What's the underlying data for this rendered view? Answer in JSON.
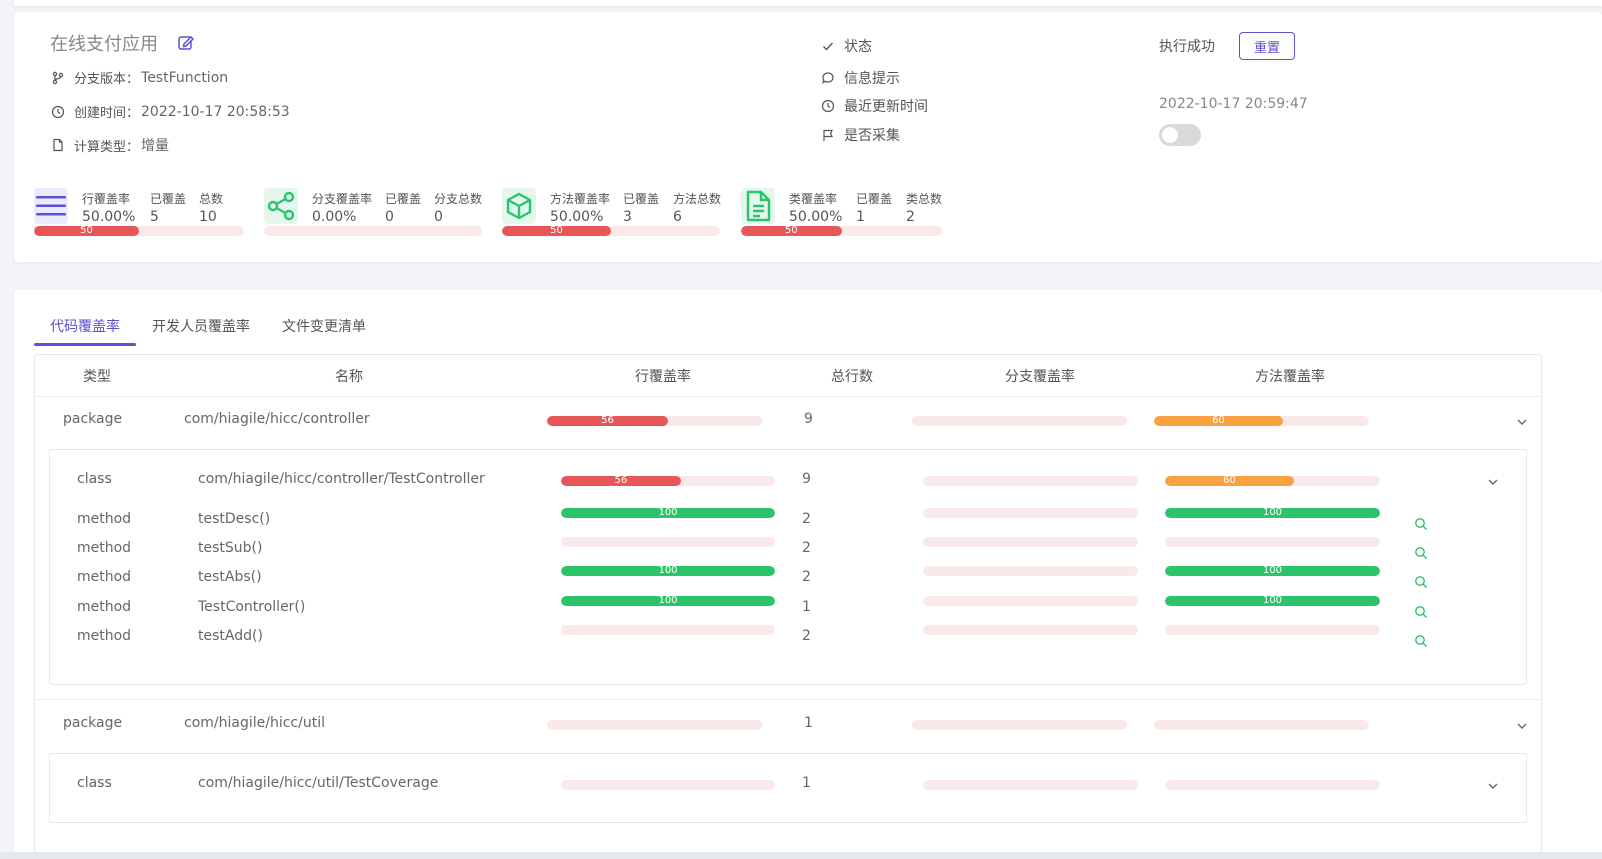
{
  "header": {
    "app_title": "在线支付应用",
    "branch_label": "分支版本：",
    "branch_value": "TestFunction",
    "created_label": "创建时间：",
    "created_value": "2022-10-17 20:58:53",
    "calc_label": "计算类型：",
    "calc_value": "增量",
    "status_label": "状态",
    "status_value": "执行成功",
    "reset_label": "重置",
    "info_label": "信息提示",
    "updated_label": "最近更新时间",
    "updated_value": "2022-10-17 20:59:47",
    "collect_label": "是否采集",
    "collect_on": false
  },
  "metrics": [
    {
      "icon": "lines-icon",
      "rate_label": "行覆盖率",
      "rate": "50.00%",
      "covered_label": "已覆盖",
      "covered": "5",
      "total_label": "总数",
      "total": "10",
      "percent": 50,
      "percent_label": "50"
    },
    {
      "icon": "share-icon",
      "rate_label": "分支覆盖率",
      "rate": "0.00%",
      "covered_label": "已覆盖",
      "covered": "0",
      "total_label": "分支总数",
      "total": "0",
      "percent": 0,
      "percent_label": ""
    },
    {
      "icon": "cube-icon",
      "rate_label": "方法覆盖率",
      "rate": "50.00%",
      "covered_label": "已覆盖",
      "covered": "3",
      "total_label": "方法总数",
      "total": "6",
      "percent": 50,
      "percent_label": "50"
    },
    {
      "icon": "document-icon",
      "rate_label": "类覆盖率",
      "rate": "50.00%",
      "covered_label": "已覆盖",
      "covered": "1",
      "total_label": "类总数",
      "total": "2",
      "percent": 50,
      "percent_label": "50"
    }
  ],
  "tabs": [
    {
      "label": "代码覆盖率",
      "active": true
    },
    {
      "label": "开发人员覆盖率",
      "active": false
    },
    {
      "label": "文件变更清单",
      "active": false
    }
  ],
  "table": {
    "headers": {
      "type": "类型",
      "name": "名称",
      "line_rate": "行覆盖率",
      "total_lines": "总行数",
      "branch_rate": "分支覆盖率",
      "method_rate": "方法覆盖率"
    },
    "rows": [
      {
        "type": "package",
        "name": "com/hiagile/hicc/controller",
        "line": 56,
        "line_label": "56",
        "lines": "9",
        "branch": 0,
        "branch_label": "",
        "method": 60,
        "method_label": "60"
      },
      {
        "type": "class",
        "name": "com/hiagile/hicc/controller/TestController",
        "line": 56,
        "line_label": "56",
        "lines": "9",
        "branch": 0,
        "branch_label": "",
        "method": 60,
        "method_label": "60"
      },
      {
        "type": "method",
        "name": "testDesc()",
        "line": 100,
        "line_label": "100",
        "lines": "2",
        "branch": 0,
        "branch_label": "",
        "method": 100,
        "method_label": "100"
      },
      {
        "type": "method",
        "name": "testSub()",
        "line": 0,
        "line_label": "",
        "lines": "2",
        "branch": 0,
        "branch_label": "",
        "method": 0,
        "method_label": ""
      },
      {
        "type": "method",
        "name": "testAbs()",
        "line": 100,
        "line_label": "100",
        "lines": "2",
        "branch": 0,
        "branch_label": "",
        "method": 100,
        "method_label": "100"
      },
      {
        "type": "method",
        "name": "TestController()",
        "line": 100,
        "line_label": "100",
        "lines": "1",
        "branch": 0,
        "branch_label": "",
        "method": 100,
        "method_label": "100"
      },
      {
        "type": "method",
        "name": "testAdd()",
        "line": 0,
        "line_label": "",
        "lines": "2",
        "branch": 0,
        "branch_label": "",
        "method": 0,
        "method_label": ""
      },
      {
        "type": "package",
        "name": "com/hiagile/hicc/util",
        "line": 0,
        "line_label": "",
        "lines": "1",
        "branch": 0,
        "branch_label": "",
        "method": 0,
        "method_label": ""
      },
      {
        "type": "class",
        "name": "com/hiagile/hicc/util/TestCoverage",
        "line": 0,
        "line_label": "",
        "lines": "1",
        "branch": 0,
        "branch_label": "",
        "method": 0,
        "method_label": ""
      }
    ]
  },
  "colors": {
    "accent": "#5b52d6",
    "red": "#e85757",
    "orange": "#f9a040",
    "green": "#2cc46a",
    "track": "#fbe9ea"
  }
}
